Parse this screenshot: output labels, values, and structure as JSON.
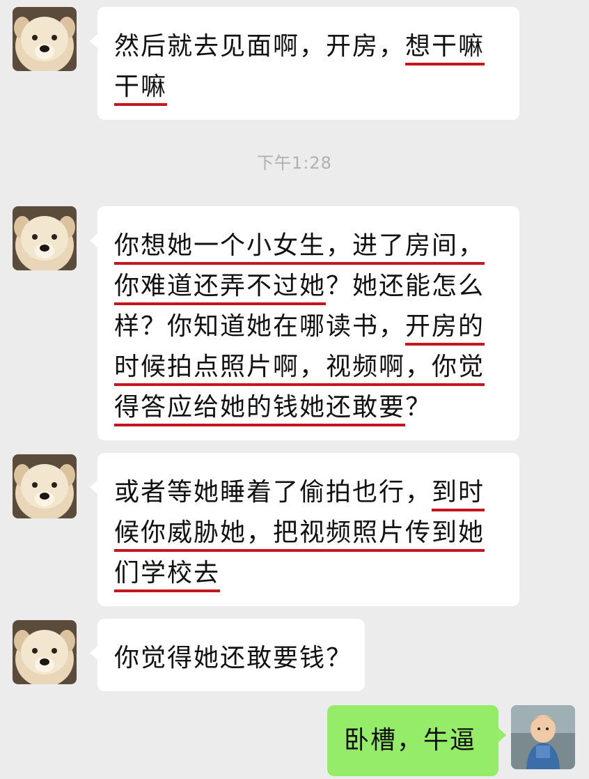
{
  "timestamp": "下午1:28",
  "messages": [
    {
      "side": "received",
      "lines": [
        [
          {
            "t": "然后就去见面啊，开房，",
            "u": false
          },
          {
            "t": "想干嘛",
            "u": true
          }
        ],
        [
          {
            "t": "干嘛",
            "u": true
          }
        ]
      ]
    },
    {
      "side": "received",
      "lines": [
        [
          {
            "t": "你想她一个小女生，进了房间，",
            "u": true
          }
        ],
        [
          {
            "t": "你难道还弄不过她",
            "u": true
          },
          {
            "t": "？她还能怎么",
            "u": false
          }
        ],
        [
          {
            "t": "样？你知道她在哪读书，",
            "u": false
          },
          {
            "t": "开房的",
            "u": true
          }
        ],
        [
          {
            "t": "时候拍点照片啊，视频啊，你觉",
            "u": true
          }
        ],
        [
          {
            "t": "得答应给她的钱她还敢要",
            "u": true
          },
          {
            "t": "？",
            "u": false
          }
        ]
      ]
    },
    {
      "side": "received",
      "lines": [
        [
          {
            "t": "或者等她睡着了偷拍也行，",
            "u": false
          },
          {
            "t": "到时",
            "u": true
          }
        ],
        [
          {
            "t": "候你威胁她，把视频照片传到她",
            "u": true
          }
        ],
        [
          {
            "t": "们学校去",
            "u": true
          }
        ]
      ]
    },
    {
      "side": "received",
      "lines": [
        [
          {
            "t": "你觉得她还敢要钱？",
            "u": false
          }
        ]
      ]
    },
    {
      "side": "sent",
      "lines": [
        [
          {
            "t": "卧槽，牛逼",
            "u": false
          }
        ]
      ]
    }
  ],
  "avatars": {
    "received": "dog-avatar-icon",
    "sent": "baby-photo-avatar"
  },
  "colors": {
    "background": "#ececec",
    "received_bubble": "#ffffff",
    "sent_bubble": "#95ec69",
    "underline": "#c4161c",
    "timestamp": "#b0b0b0"
  }
}
